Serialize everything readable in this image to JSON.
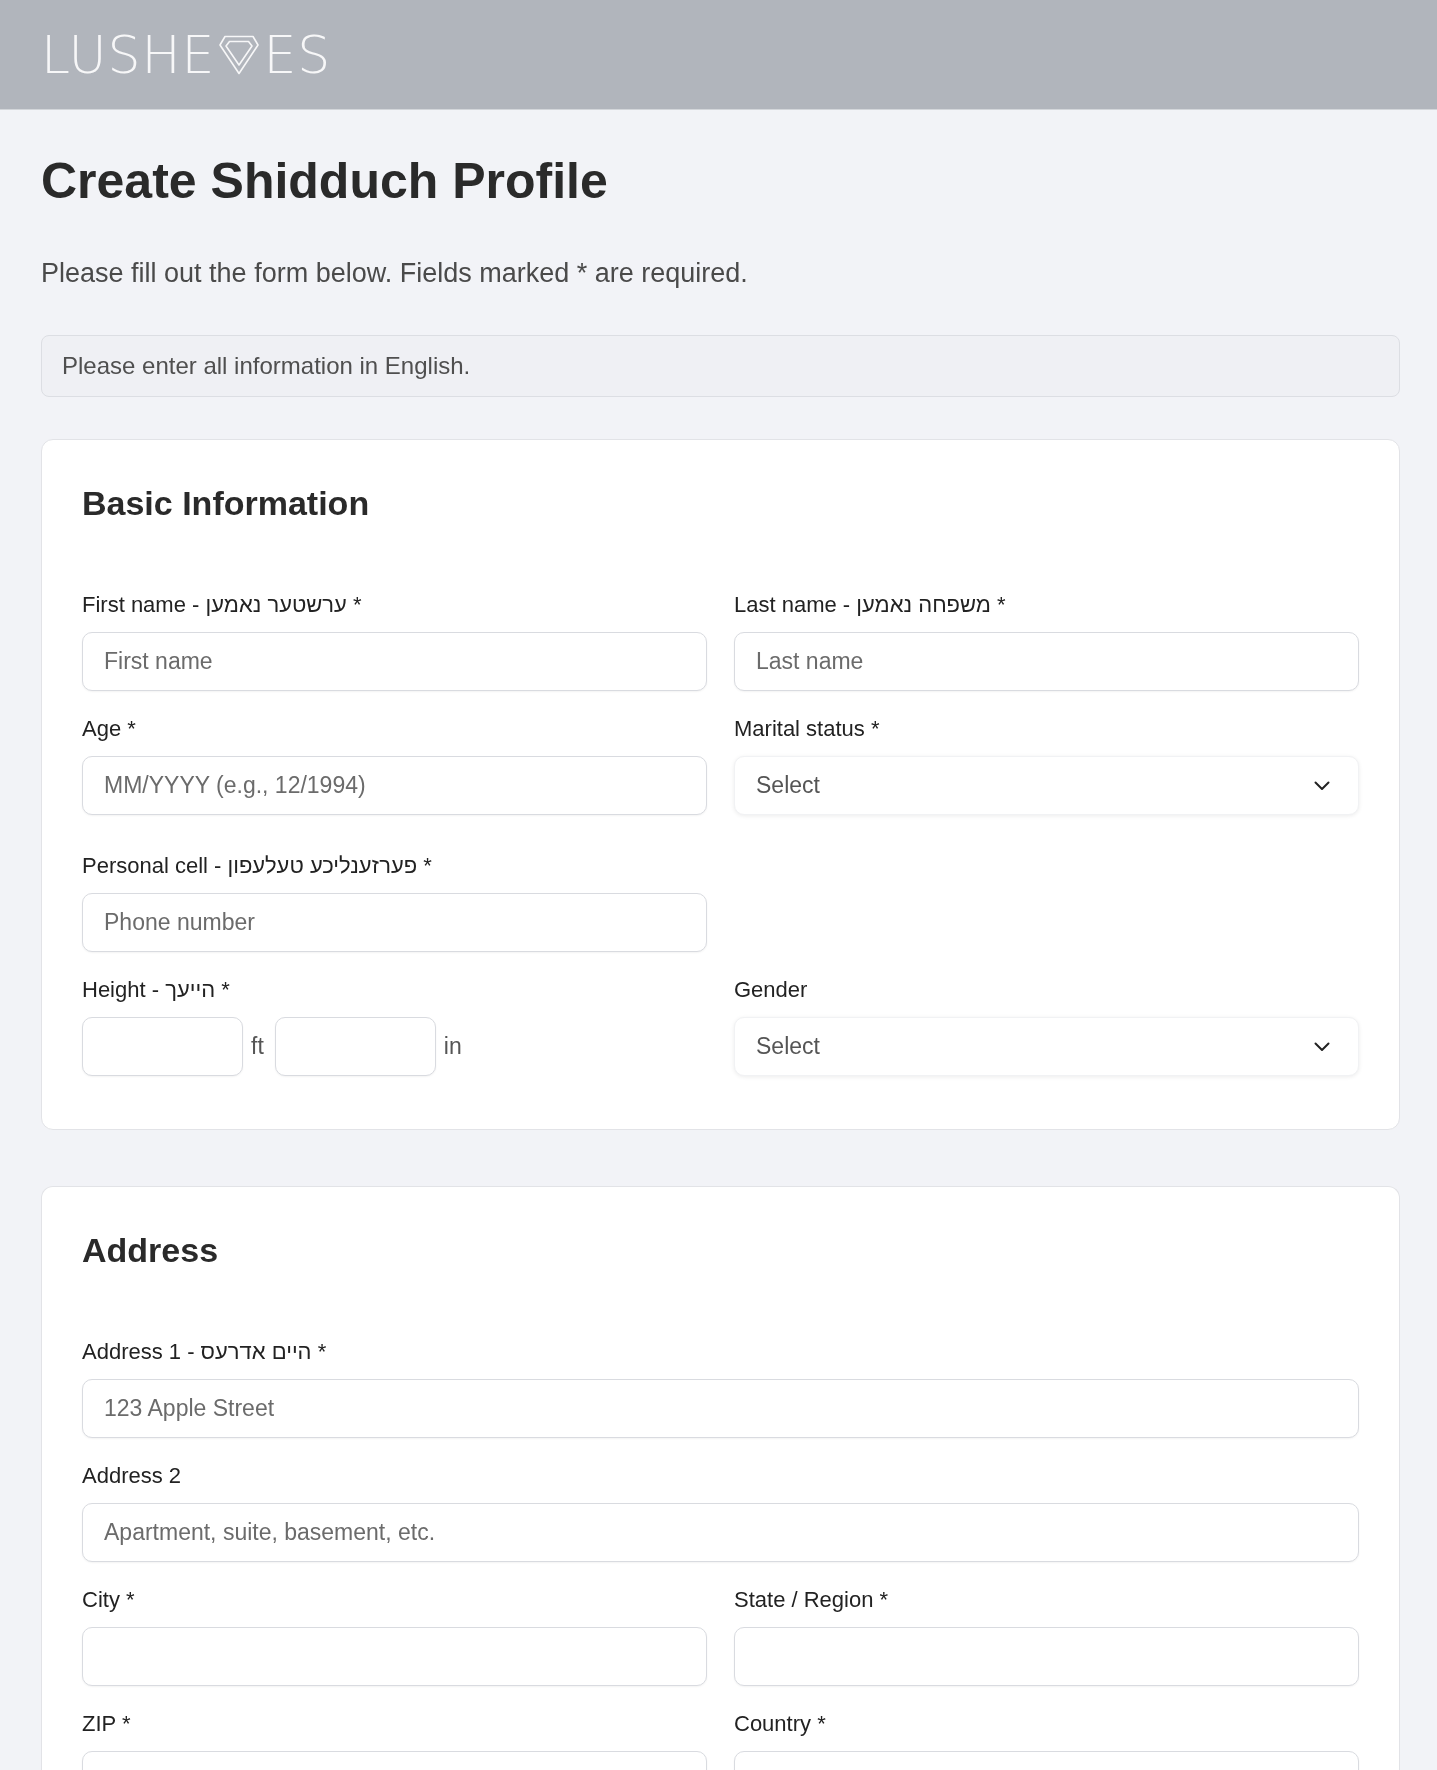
{
  "header": {
    "logo": {
      "before": "LUSHE",
      "after": "ES"
    }
  },
  "title": "Create Shidduch Profile",
  "intro": "Please fill out the form below. Fields marked * are required.",
  "notice": "Please enter all information in English.",
  "sections": [
    {
      "title": "Basic Information",
      "rows": [
        [
          {
            "kind": "text",
            "label": "First name - ערשטער נאמען *",
            "placeholder": "First name"
          },
          {
            "kind": "text",
            "label": "Last name - משפחה נאמען *",
            "placeholder": "Last name"
          }
        ],
        [
          {
            "kind": "text",
            "label": "Age *",
            "placeholder": "MM/YYYY (e.g., 12/1994)"
          },
          {
            "kind": "select",
            "label": "Marital status *",
            "placeholder": "Select"
          }
        ],
        [
          {
            "kind": "text",
            "label": "Personal cell - פערזענליכע טעלעפון *",
            "placeholder": "Phone number"
          }
        ],
        [
          {
            "kind": "height",
            "label": "Height - הייעך *",
            "units": [
              "ft",
              "in"
            ]
          },
          {
            "kind": "select",
            "label": "Gender",
            "placeholder": "Select"
          }
        ]
      ]
    },
    {
      "title": "Address",
      "rows": [
        [
          {
            "kind": "wide_text",
            "label": "Address 1 - היים אדרעס *",
            "placeholder": "123 Apple Street"
          }
        ],
        [
          {
            "kind": "wide_text",
            "label": "Address 2",
            "placeholder": "Apartment, suite, basement, etc."
          }
        ],
        [
          {
            "kind": "text",
            "label": "City *"
          },
          {
            "kind": "text",
            "label": "State / Region *"
          }
        ],
        [
          {
            "kind": "text",
            "label": "ZIP *"
          },
          {
            "kind": "text",
            "label": "Country *"
          }
        ]
      ]
    }
  ]
}
